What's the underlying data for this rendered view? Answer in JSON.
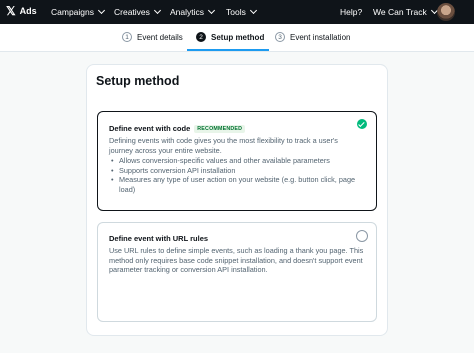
{
  "topbar": {
    "logo_text": "Ads",
    "nav": [
      {
        "label": "Campaigns"
      },
      {
        "label": "Creatives"
      },
      {
        "label": "Analytics"
      },
      {
        "label": "Tools"
      }
    ],
    "help_label": "Help?",
    "account_label": "We Can Track",
    "colors": {
      "background": "#0f1419",
      "text": "#ffffff"
    }
  },
  "steps": [
    {
      "number": "1",
      "label": "Event details",
      "active": false
    },
    {
      "number": "2",
      "label": "Setup method",
      "active": true
    },
    {
      "number": "3",
      "label": "Event installation",
      "active": false
    }
  ],
  "main": {
    "title": "Setup method",
    "options": [
      {
        "title": "Define event with code",
        "badge": "RECOMMENDED",
        "selected": true,
        "description": "Defining events with code gives you the most flexibility to track a user's journey across your entire website.",
        "bullets": [
          "Allows conversion-specific values and other available parameters",
          "Supports conversion API installation",
          "Measures any type of user action on your website (e.g. button click, page load)"
        ]
      },
      {
        "title": "Define event with URL rules",
        "selected": false,
        "description": "Use URL rules to define simple events, such as loading a thank you page. This method only requires base code snippet installation, and doesn't support event parameter tracking or conversion API installation."
      }
    ]
  },
  "colors": {
    "accent": "#1d9bf0",
    "success": "#00ba7c",
    "badge_bg": "#e8f5e9",
    "badge_text": "#00732f"
  }
}
